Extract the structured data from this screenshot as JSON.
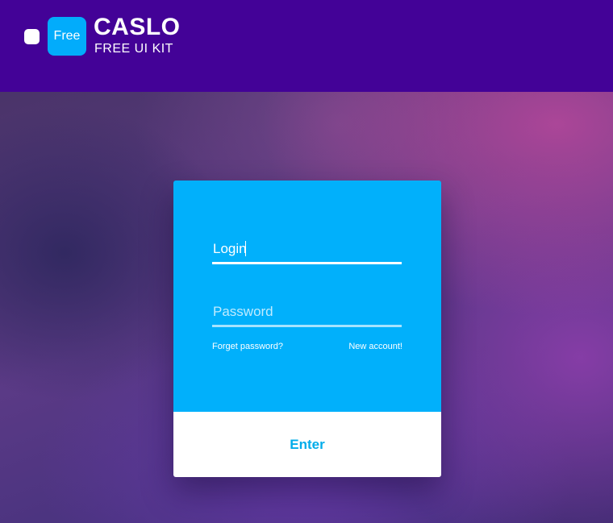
{
  "header": {
    "badge_label": "Free",
    "brand_title": "CASLO",
    "brand_subtitle": "FREE UI KIT"
  },
  "login_form": {
    "login_value": "Login",
    "password_placeholder": "Password",
    "forgot_password_label": "Forget password?",
    "new_account_label": "New account!",
    "enter_label": "Enter"
  },
  "colors": {
    "header_bg": "#430297",
    "accent_blue": "#01b0fb",
    "enter_text": "#01acea",
    "card_bottom": "#ffffff"
  }
}
